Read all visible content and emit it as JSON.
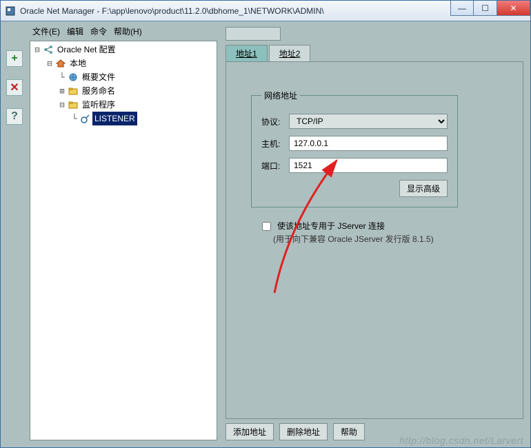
{
  "window": {
    "title": "Oracle Net Manager - F:\\app\\lenovo\\product\\11.2.0\\dbhome_1\\NETWORK\\ADMIN\\"
  },
  "menu": {
    "file": "文件(E)",
    "edit": "编辑",
    "command": "命令",
    "help": "帮助(H)"
  },
  "tree": {
    "root": "Oracle Net 配置",
    "local": "本地",
    "profile": "概要文件",
    "naming": "服务命名",
    "listeners": "监听程序",
    "listener": "LISTENER"
  },
  "tabs": {
    "addr1": "地址1",
    "addr2": "地址2"
  },
  "addr": {
    "legend": "网络地址",
    "protocol_label": "协议:",
    "protocol_value": "TCP/IP",
    "host_label": "主机:",
    "host_value": "127.0.0.1",
    "port_label": "端口:",
    "port_value": "1521",
    "show_advanced": "显示高级"
  },
  "jserver": {
    "checkbox": "使该地址专用于 JServer 连接",
    "hint": "(用于向下兼容 Oracle JServer 发行版 8.1.5)"
  },
  "buttons": {
    "add": "添加地址",
    "remove": "删除地址",
    "help": "帮助"
  },
  "watermark": "http://blog.csdn.net/Larvert"
}
